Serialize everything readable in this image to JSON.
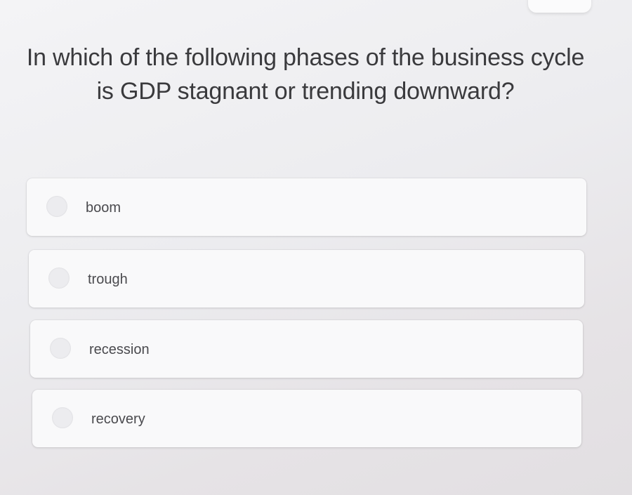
{
  "question": {
    "text": "In which of the following phases of the business cycle is GDP stagnant or trending downward?"
  },
  "options": [
    {
      "label": "boom",
      "selected": false
    },
    {
      "label": "trough",
      "selected": false
    },
    {
      "label": "recession",
      "selected": false
    },
    {
      "label": "recovery",
      "selected": false
    }
  ]
}
